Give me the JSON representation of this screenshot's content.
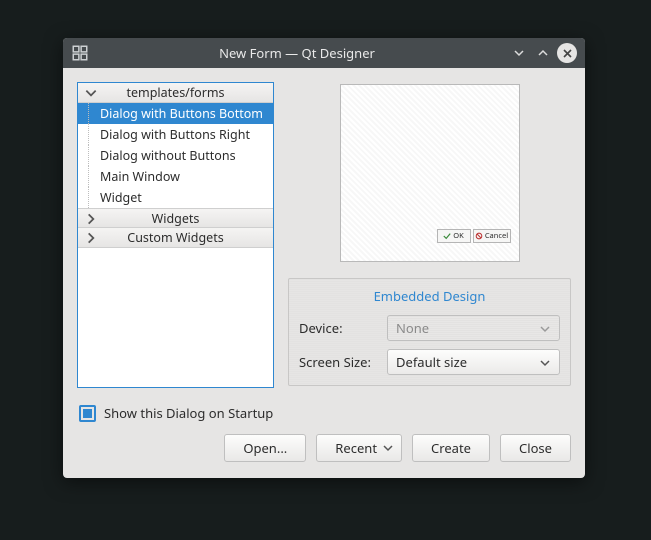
{
  "titlebar": {
    "title": "New Form — Qt Designer"
  },
  "tree": {
    "group1_label": "templates/forms",
    "items": [
      "Dialog with Buttons Bottom",
      "Dialog with Buttons Right",
      "Dialog without Buttons",
      "Main Window",
      "Widget"
    ],
    "selected_index": 0,
    "group2_label": "Widgets",
    "group3_label": "Custom Widgets"
  },
  "preview": {
    "ok": "OK",
    "cancel": "Cancel"
  },
  "embedded": {
    "title": "Embedded Design",
    "device_label": "Device:",
    "device_value": "None",
    "screen_label": "Screen Size:",
    "screen_value": "Default size"
  },
  "checkbox": {
    "label": "Show this Dialog on Startup",
    "checked": true
  },
  "buttons": {
    "open": "Open...",
    "recent": "Recent",
    "create": "Create",
    "close": "Close"
  }
}
